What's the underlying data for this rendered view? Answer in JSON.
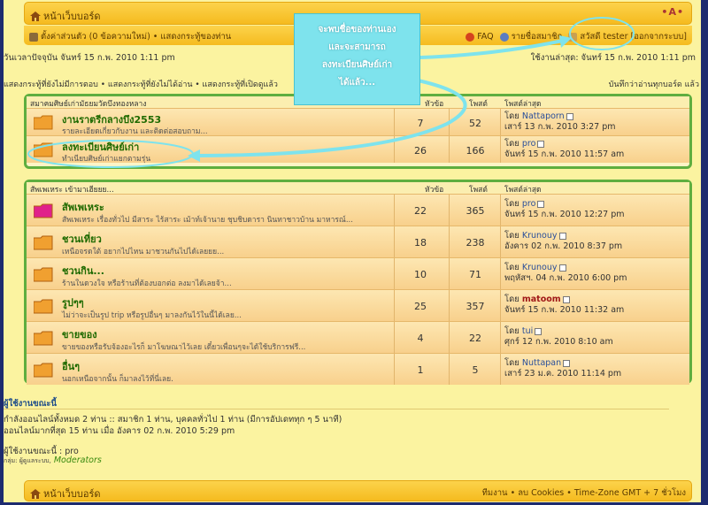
{
  "header": {
    "home_label": "หน้าเว็บบอร์ด",
    "font_size_label": "•A•"
  },
  "menu": {
    "profile_label": "ตั้งค่าส่วนตัว (0 ข้อความใหม่) • แสดงกระทู้ของท่าน",
    "faq_label": "FAQ",
    "members_label": "รายชื่อสมาชิก",
    "greeting_label": "สวัสดี tester [ออกจากระบบ]"
  },
  "info": {
    "current_time": "วันเวลาปัจจุบัน จันทร์ 15 ก.พ. 2010 1:11 pm",
    "last_visit": "ใช้งานล่าสุด: จันทร์ 15 ก.พ. 2010 1:11 pm",
    "quick_links": "แสดงกระทู้ที่ยังไม่มีการตอบ • แสดงกระทู้ที่ยังไม่ได้อ่าน • แสดงกระทู้ที่เปิดดูแล้ว",
    "mark_read": "บันทึกว่าอ่านทุกบอร์ด แล้ว"
  },
  "callout": {
    "lines": [
      "จะพบชื่อของท่านเอง",
      "และจะสามารถ",
      "ลงทะเบียนศิษย์เก่า",
      "ได้แล้ว..."
    ]
  },
  "category1": {
    "title": "สมาคมศิษย์เก่ามัธยมวัดบึงทองหลาง",
    "col_topics": "หัวข้อ",
    "col_posts": "โพสต์",
    "col_last": "โพสต์ล่าสุด",
    "forums": [
      {
        "title": "งานราตรีกลางบึง2553",
        "desc": "รายละเอียดเกี่ยวกับงาน และติดต่อสอบถาม...",
        "topics": "7",
        "posts": "52",
        "by": "โดย",
        "user": "Nattaporn",
        "date": "เสาร์ 13 ก.พ. 2010 3:27 pm"
      },
      {
        "title": "ลงทะเบียนศิษย์เก่า",
        "desc": "ทำเนียบศิษย์เก่าแยกตามรุ่น",
        "topics": "26",
        "posts": "166",
        "by": "โดย",
        "user": "pro",
        "date": "จันทร์ 15 ก.พ. 2010 11:57 am"
      }
    ]
  },
  "category2": {
    "title": "สัพเพเหระ เข้ามาเฮียยย...",
    "col_topics": "หัวข้อ",
    "col_posts": "โพสต์",
    "col_last": "โพสต์ล่าสุด",
    "forums": [
      {
        "title": "สัพเพเหระ",
        "desc": "สัพเพเหระ เรื่องทั่วไป มีสาระ ไร้สาระ เม้าท์เจ้านาย ชุบชิบดารา นินทาชาวบ้าน มาหารณ์...",
        "topics": "22",
        "posts": "365",
        "by": "โดย",
        "user": "pro",
        "date": "จันทร์ 15 ก.พ. 2010 12:27 pm",
        "color": "#e0218a"
      },
      {
        "title": "ชวนเที่ยว",
        "desc": "เหนือจรดใต้ อยากไปไหน มาชวนกันไปได้เลยยย...",
        "topics": "18",
        "posts": "238",
        "by": "โดย",
        "user": "Krunouy",
        "date": "อังคาร 02 ก.พ. 2010 8:37 pm",
        "color": "#f0a030"
      },
      {
        "title": "ชวนกิน...",
        "desc": "ร้านในดวงใจ หรือร้านที่ต้องบอกต่อ ลงมาได้เลยจ้า...",
        "topics": "10",
        "posts": "71",
        "by": "โดย",
        "user": "Krunouy",
        "date": "พฤหัสฯ. 04 ก.พ. 2010 6:00 pm",
        "color": "#f0a030"
      },
      {
        "title": "รูปๆๆ",
        "desc": "ไม่ว่าจะเป็นรูป trip หรือรูปอื่นๆ มาลงกันไว้ในนี้ได้เลย...",
        "topics": "25",
        "posts": "357",
        "by": "โดย",
        "user": "matoom",
        "date": "จันทร์ 15 ก.พ. 2010 11:32 am",
        "color": "#f0a030",
        "admin": true
      },
      {
        "title": "ขายของ",
        "desc": "ขายของหรือรับจ้องอะไรก็ มาโฆษณาไว้เลย เดี๋ยวเพื่อนๆจะได้ใช้บริการฟรี...",
        "topics": "4",
        "posts": "22",
        "by": "โดย",
        "user": "tui",
        "date": "ศุกร์ 12 ก.พ. 2010 8:10 am",
        "color": "#f0a030"
      },
      {
        "title": "อื่นๆ",
        "desc": "นอกเหนือจากนั้น ก็มาลงไว้ที่นี่เลย.",
        "topics": "1",
        "posts": "5",
        "by": "โดย",
        "user": "Nuttapan",
        "date": "เสาร์ 23 ม.ค. 2010 11:14 pm",
        "color": "#f0a030"
      }
    ]
  },
  "online": {
    "title": "ผู้ใช้งานขณะนี้",
    "summary": "กำลังออนไลน์ทั้งหมด 2 ท่าน :: สมาชิก 1 ท่าน, บุคคลทั่วไป 1 ท่าน (มีการอัปเดททุก ๆ 5 นาที)",
    "record": "ออนไลน์มากที่สุด 15 ท่าน เมื่อ อังคาร 02 ก.พ. 2010 5:29 pm",
    "users": "ผู้ใช้งานขณะนี้ : pro",
    "legend": "กลุ่ม: ผู้ดูแลระบบ,",
    "moderators": "Moderators"
  },
  "footer": {
    "home_label": "หน้าเว็บบอร์ด",
    "right_label": "ทีมงาน • ลบ Cookies • Time-Zone GMT + 7 ชั่วโมง"
  },
  "colors": {
    "accent_yellow": "#f5bb1f",
    "border_green": "#5fae3f",
    "callout_cyan": "#7ee3ed",
    "title_green": "#1f6a00"
  }
}
